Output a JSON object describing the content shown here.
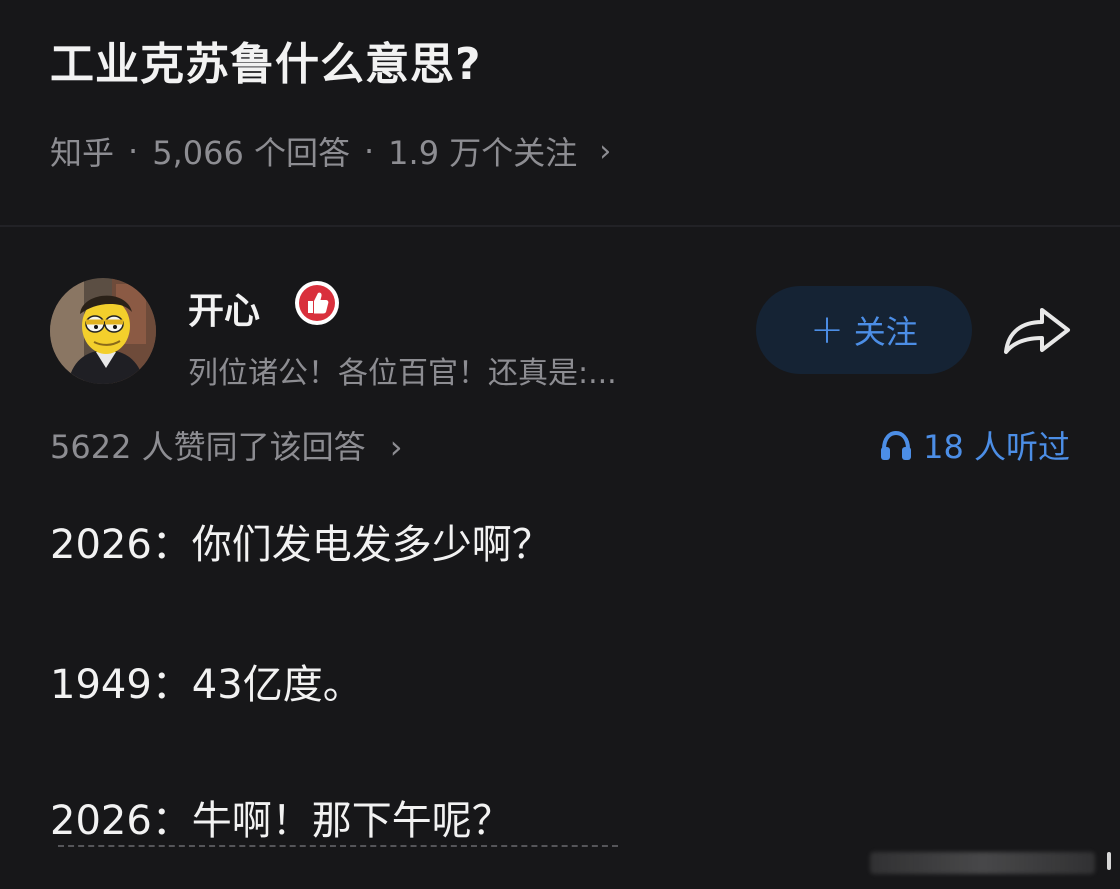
{
  "question": {
    "title": "工业克苏鲁什么意思?",
    "source": "知乎",
    "answers_count": "5,066 个回答",
    "followers_count": "1.9 万个关注",
    "dot": "·",
    "chevron": "›"
  },
  "author": {
    "name": "开心",
    "bio": "列位诸公！各位百官！还真是:...",
    "badge_icon": "thumbs-up-badge-icon",
    "avatar_icon": "cartoon-avatar"
  },
  "actions": {
    "follow_plus": "+",
    "follow_label": "关注",
    "share_icon": "share-arrow-icon"
  },
  "stats": {
    "upvotes": "5622 人赞同了该回答",
    "chevron": "›",
    "listeners": "18 人听过",
    "listen_icon": "headphones-icon"
  },
  "answer": {
    "lines": [
      "2026：你们发电发多少啊？",
      "1949：43亿度。",
      "2026：牛啊！那下午呢？"
    ]
  },
  "colors": {
    "background": "#171719",
    "accent": "#4c8ee6",
    "badge_red": "#d9303c",
    "muted": "#8d8d92"
  }
}
